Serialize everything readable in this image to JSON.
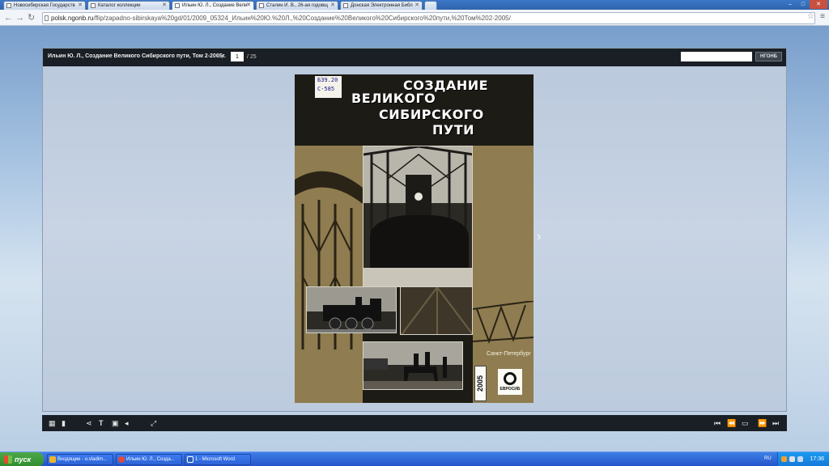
{
  "browser": {
    "tabs": [
      {
        "label": "Новосибирская Государств"
      },
      {
        "label": "Каталог коллекции"
      },
      {
        "label": "Ильин Ю. Л., Создание Вели"
      },
      {
        "label": "Сталин И. В., 26-ая годовщ"
      },
      {
        "label": "Донская Электронная Библ"
      }
    ],
    "url_host": "polsk.ngonb.ru",
    "url_path": "/flip/zapadno-sibirskaya%20gd/01/2009_05324_Ильин%20Ю.%20Л.,%20Создание%20Великого%20Сибирского%20пути,%20Том%202-2005/"
  },
  "viewer": {
    "title": "Ильин Ю. Л., Создание Великого Сибирского пути, Том 2-2005г.",
    "page_label": "стр.",
    "page_current": "1",
    "page_total": "/ 25",
    "search_placeholder": "",
    "search_button": "НГОНБ"
  },
  "cover": {
    "title_lines": [
      "СОЗДАНИЕ",
      "ВЕЛИКОГО",
      "СИБИРСКОГО",
      "ПУТИ"
    ],
    "stamp_line1": "Б39.20",
    "stamp_line2": "С-585",
    "city": "Санкт-Петербург",
    "year": "2005",
    "publisher": "ЕВРОСИБ"
  },
  "taskbar": {
    "start_label": "пуск",
    "tasks": [
      {
        "label": "Входящие - o.vladim..."
      },
      {
        "label": "Ильин Ю. Л., Созда..."
      },
      {
        "label": "1 - Microsoft Word"
      }
    ],
    "lang": "RU",
    "time": "17:36"
  }
}
